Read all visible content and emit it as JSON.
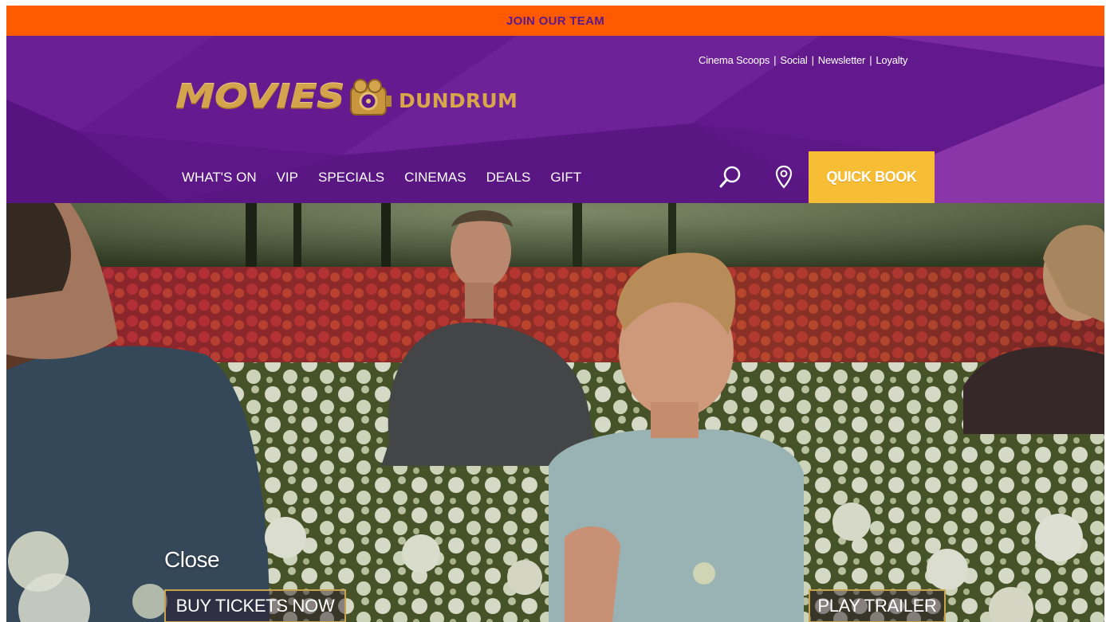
{
  "banner": {
    "label": "JOIN OUR TEAM"
  },
  "header": {
    "top_links": [
      "Cinema Scoops",
      "Social",
      "Newsletter",
      "Loyalty"
    ],
    "logo": {
      "word": "MOVIES",
      "suffix": "DUNDRUM",
      "color": "#d4a44c"
    },
    "nav": [
      "WHAT'S ON",
      "VIP",
      "SPECIALS",
      "CINEMAS",
      "DEALS",
      "GIFT"
    ],
    "icons": {
      "search": "search-icon",
      "location": "location-pin-icon"
    },
    "quick_book": "QUICK BOOK",
    "colors": {
      "purple": "#5e1787",
      "orange": "#ff5a00",
      "gold": "#f7be35"
    }
  },
  "hero": {
    "close_label": "Close",
    "buy_label": "BUY TICKETS NOW",
    "trailer_label": "PLAY TRAILER"
  }
}
